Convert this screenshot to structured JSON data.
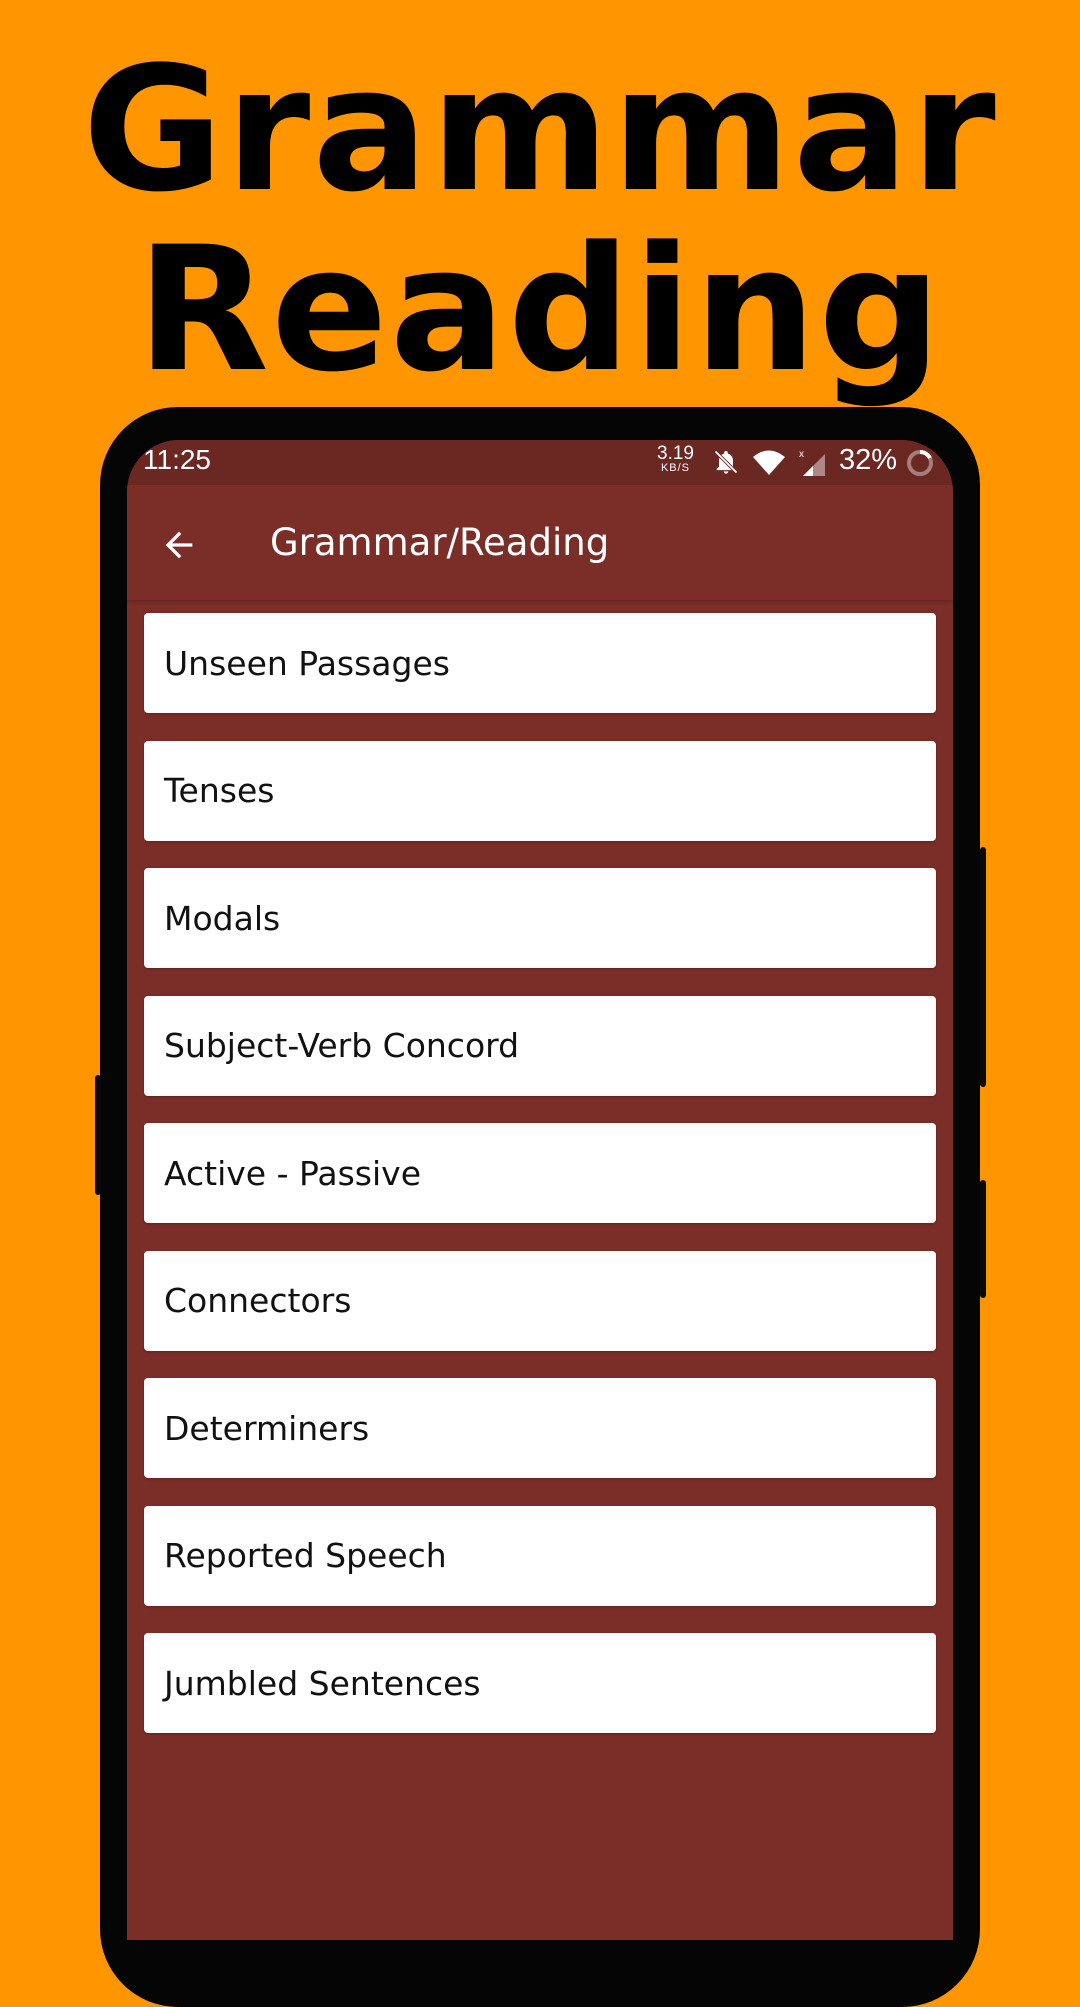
{
  "promo": {
    "line1": "Grammar",
    "line2": "Reading"
  },
  "status_bar": {
    "time": "11:25",
    "net_speed_value": "3.19",
    "net_speed_unit": "KB/S",
    "icons": [
      "bell-off-icon",
      "wifi-icon",
      "signal-icon",
      "battery-icon"
    ],
    "battery": "32%"
  },
  "app_bar": {
    "title": "Grammar/Reading",
    "back_icon": "arrow-left-icon"
  },
  "topics": [
    {
      "label": "Unseen Passages"
    },
    {
      "label": "Tenses"
    },
    {
      "label": "Modals"
    },
    {
      "label": "Subject-Verb Concord"
    },
    {
      "label": "Active - Passive"
    },
    {
      "label": "Connectors"
    },
    {
      "label": "Determiners"
    },
    {
      "label": "Reported Speech"
    },
    {
      "label": "Jumbled Sentences"
    }
  ],
  "colors": {
    "background": "#FF9500",
    "primary": "#7B2D28",
    "status_bar": "#6B2722",
    "card": "#FFFFFF"
  }
}
